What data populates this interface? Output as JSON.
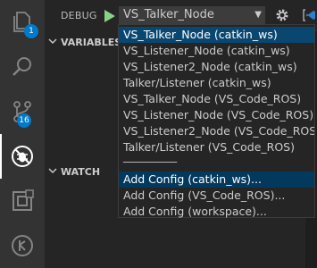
{
  "debug": {
    "title": "DEBUG",
    "selected_config": "VS_Talker_Node",
    "caret": "▼"
  },
  "sections": {
    "variables": "VARIABLES",
    "watch": "WATCH"
  },
  "badges": {
    "explorer": "1",
    "scm": "16"
  },
  "dropdown": {
    "items": [
      "VS_Talker_Node (catkin_ws)",
      "VS_Listener_Node (catkin_ws)",
      "VS_Listener2_Node (catkin_ws)",
      "Talker/Listener (catkin_ws)",
      "VS_Talker_Node (VS_Code_ROS)",
      "VS_Listener_Node (VS_Code_ROS)",
      "VS_Listener2_Node (VS_Code_ROS)",
      "Talker/Listener (VS_Code_ROS)"
    ],
    "separator": "──────────",
    "add_items": [
      "Add Config (catkin_ws)...",
      "Add Config (VS_Code_ROS)...",
      "Add Config (workspace)..."
    ],
    "selected_index": 0
  },
  "colors": {
    "activity_bar": "#333333",
    "sidebar": "#252526",
    "badge": "#007acc",
    "play": "#89d185",
    "selection": "#094771"
  }
}
